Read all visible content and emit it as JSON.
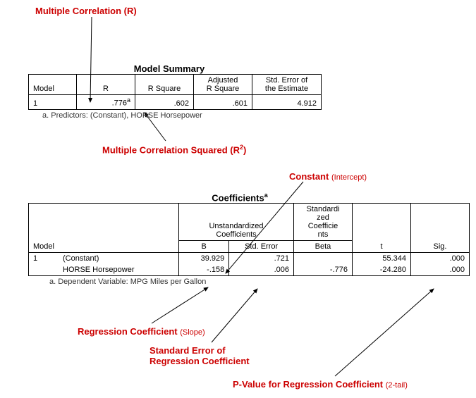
{
  "annotations": {
    "multR": "Multiple Correlation (R)",
    "multR2_a": "Multiple Correlation Squared (R",
    "multR2_b": ")",
    "constant_a": "Constant",
    "constant_b": "(Intercept)",
    "regCoef_a": "Regression Coefficient",
    "regCoef_b": "(Slope)",
    "stdErr_a": "Standard Error of",
    "stdErr_b": "Regression Coefficient",
    "pval_a": "P-Value for Regression Coefficient",
    "pval_b": "(2-tail)"
  },
  "modelSummary": {
    "title": "Model Summary",
    "headers": {
      "model": "Model",
      "r": "R",
      "rsq": "R Square",
      "adjRsq_a": "Adjusted",
      "adjRsq_b": "R Square",
      "stdErr_a": "Std. Error of",
      "stdErr_b": "the Estimate"
    },
    "row": {
      "model": "1",
      "r": ".776",
      "r_sup": "a",
      "rsq": ".602",
      "adjRsq": ".601",
      "stdErr": "4.912"
    },
    "footnote": "a. Predictors: (Constant), HORSE  Horsepower"
  },
  "coefficients": {
    "title": "Coefficients",
    "title_sup": "a",
    "headers": {
      "model": "Model",
      "unstd": "Unstandardized\nCoefficients",
      "std": "Standardi\nzed\nCoefficie\nnts",
      "B": "B",
      "stdErr": "Std. Error",
      "beta": "Beta",
      "t": "t",
      "sig": "Sig."
    },
    "rows": [
      {
        "model": "1",
        "label": "(Constant)",
        "B": "39.929",
        "SE": ".721",
        "beta": "",
        "t": "55.344",
        "sig": ".000"
      },
      {
        "model": "",
        "label": "HORSE  Horsepower",
        "B": "-.158",
        "SE": ".006",
        "beta": "-.776",
        "t": "-24.280",
        "sig": ".000"
      }
    ],
    "footnote": "a. Dependent Variable: MPG  Miles per Gallon"
  }
}
